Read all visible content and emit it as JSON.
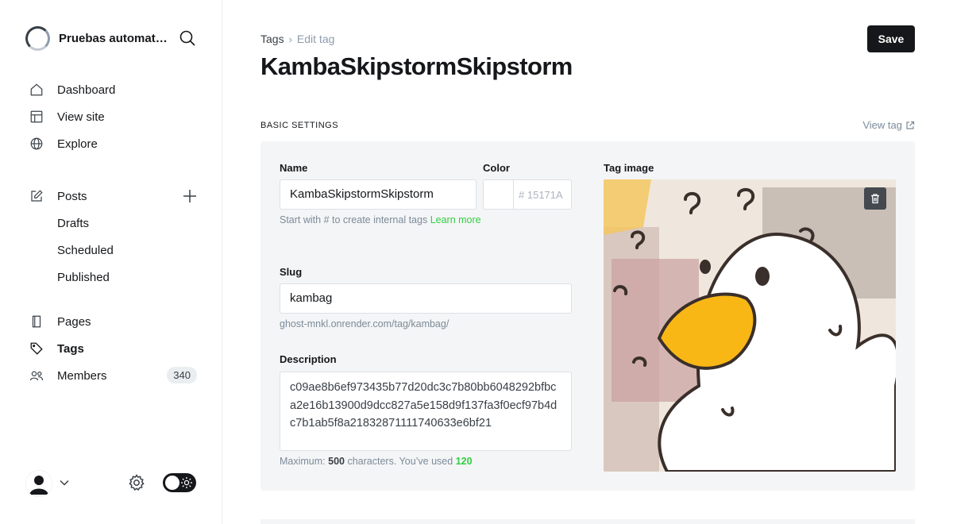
{
  "sidebar": {
    "site_title": "Pruebas automatizadas",
    "nav_main": [
      {
        "label": "Dashboard"
      },
      {
        "label": "View site"
      },
      {
        "label": "Explore"
      }
    ],
    "posts": {
      "label": "Posts",
      "sub": [
        {
          "label": "Drafts"
        },
        {
          "label": "Scheduled"
        },
        {
          "label": "Published"
        }
      ]
    },
    "nav_secondary": [
      {
        "label": "Pages"
      },
      {
        "label": "Tags"
      },
      {
        "label": "Members",
        "count": "340"
      }
    ]
  },
  "breadcrumb": {
    "parent": "Tags",
    "separator": "›",
    "current": "Edit tag"
  },
  "header": {
    "title": "KambaSkipstormSkipstorm",
    "save_label": "Save"
  },
  "section": {
    "heading": "BASIC SETTINGS",
    "view_tag_label": "View tag"
  },
  "form": {
    "name_label": "Name",
    "name_value": "KambaSkipstormSkipstorm",
    "name_hint": "Start with # to create internal tags",
    "name_hint_link": "Learn more",
    "color_label": "Color",
    "color_hash": "#",
    "color_placeholder": "15171A",
    "slug_label": "Slug",
    "slug_value": "kambag",
    "slug_url": "ghost-mnkl.onrender.com/tag/kambag/",
    "description_label": "Description",
    "description_value": "c09ae8b6ef973435b77d20dc3c7b80bb6048292bfbca2e16b13900d9dcc827a5e158d9f137fa3f0ecf97b4dc7b1ab5f8a21832871111740633e6bf21",
    "desc_hint_prefix": "Maximum:",
    "desc_max": "500",
    "desc_hint_mid": "characters. You’ve used",
    "desc_used": "120",
    "image_label": "Tag image"
  },
  "colors": {
    "accent": "#30cf43",
    "primary": "#15171a",
    "panel": "#f4f5f6",
    "duck_beak": "#f9b716"
  }
}
